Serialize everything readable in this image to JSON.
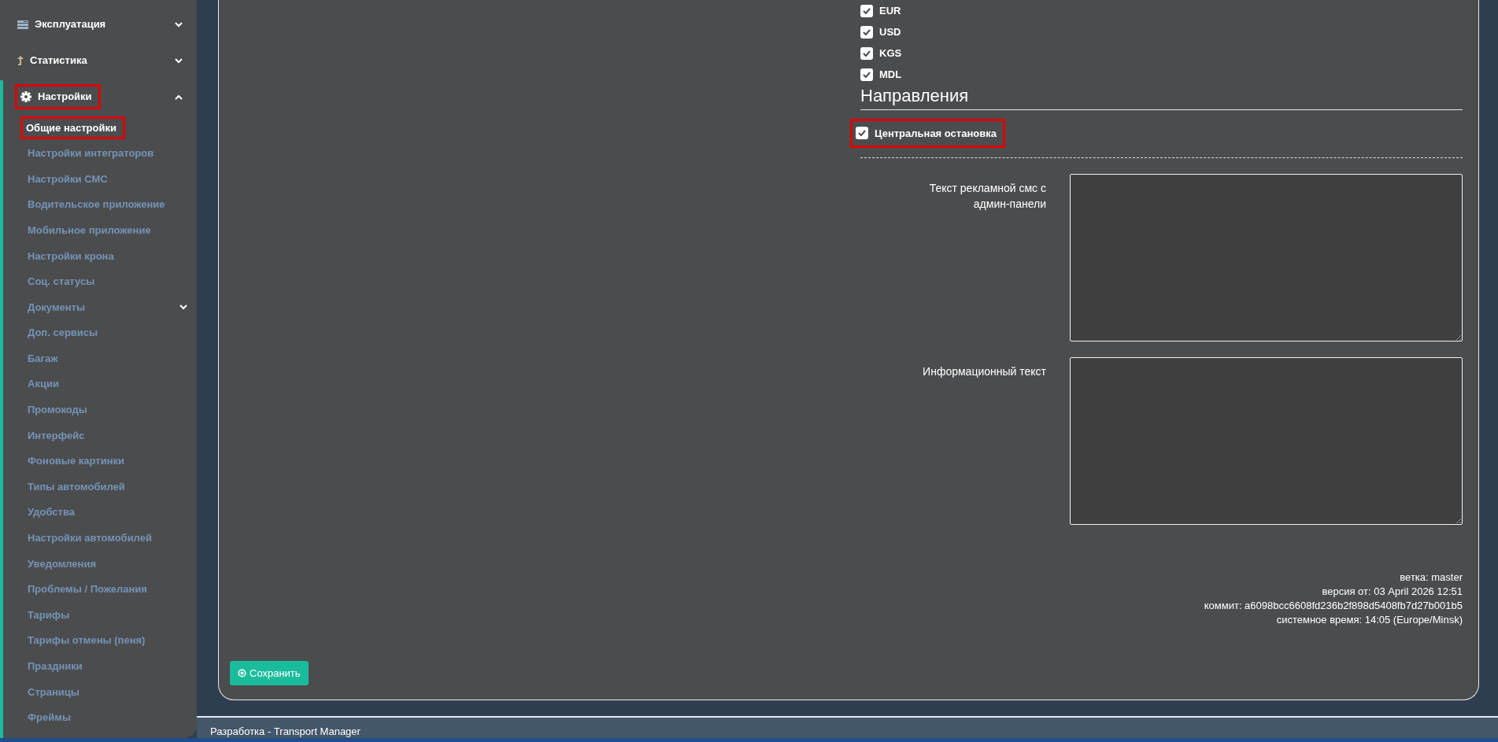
{
  "sidebar": {
    "items": [
      {
        "label": "Эксплуатация",
        "expanded": false,
        "highlighted": false
      },
      {
        "label": "Статистика",
        "expanded": false,
        "highlighted": false
      },
      {
        "label": "Настройки",
        "expanded": true,
        "highlighted": true,
        "children": [
          {
            "label": "Общие настройки",
            "selected": true,
            "highlighted": true,
            "submenu": false
          },
          {
            "label": "Настройки интеграторов",
            "selected": false,
            "highlighted": false,
            "submenu": false
          },
          {
            "label": "Настройки СМС",
            "selected": false,
            "highlighted": false,
            "submenu": false
          },
          {
            "label": "Водительское приложение",
            "selected": false,
            "highlighted": false,
            "submenu": false
          },
          {
            "label": "Мобильное приложение",
            "selected": false,
            "highlighted": false,
            "submenu": false
          },
          {
            "label": "Настройки крона",
            "selected": false,
            "highlighted": false,
            "submenu": false
          },
          {
            "label": "Соц. статусы",
            "selected": false,
            "highlighted": false,
            "submenu": false
          },
          {
            "label": "Документы",
            "selected": false,
            "highlighted": false,
            "submenu": true
          },
          {
            "label": "Доп. сервисы",
            "selected": false,
            "highlighted": false,
            "submenu": false
          },
          {
            "label": "Багаж",
            "selected": false,
            "highlighted": false,
            "submenu": false
          },
          {
            "label": "Акции",
            "selected": false,
            "highlighted": false,
            "submenu": false
          },
          {
            "label": "Промокоды",
            "selected": false,
            "highlighted": false,
            "submenu": false
          },
          {
            "label": "Интерфейс",
            "selected": false,
            "highlighted": false,
            "submenu": false
          },
          {
            "label": "Фоновые картинки",
            "selected": false,
            "highlighted": false,
            "submenu": false
          },
          {
            "label": "Типы автомобилей",
            "selected": false,
            "highlighted": false,
            "submenu": false
          },
          {
            "label": "Удобства",
            "selected": false,
            "highlighted": false,
            "submenu": false
          },
          {
            "label": "Настройки автомобилей",
            "selected": false,
            "highlighted": false,
            "submenu": false
          },
          {
            "label": "Уведомления",
            "selected": false,
            "highlighted": false,
            "submenu": false
          },
          {
            "label": "Проблемы / Пожелания",
            "selected": false,
            "highlighted": false,
            "submenu": false
          },
          {
            "label": "Тарифы",
            "selected": false,
            "highlighted": false,
            "submenu": false
          },
          {
            "label": "Тарифы отмены (пеня)",
            "selected": false,
            "highlighted": false,
            "submenu": false
          },
          {
            "label": "Праздники",
            "selected": false,
            "highlighted": false,
            "submenu": false
          },
          {
            "label": "Страницы",
            "selected": false,
            "highlighted": false,
            "submenu": false
          },
          {
            "label": "Фреймы",
            "selected": false,
            "highlighted": false,
            "submenu": false
          }
        ]
      }
    ]
  },
  "currencies": [
    {
      "label": "EUR",
      "checked": true
    },
    {
      "label": "USD",
      "checked": true
    },
    {
      "label": "KGS",
      "checked": true
    },
    {
      "label": "MDL",
      "checked": true
    }
  ],
  "directions": {
    "heading": "Направления",
    "options": [
      {
        "label": "Центральная остановка",
        "checked": true,
        "highlighted": true
      }
    ]
  },
  "fields": [
    {
      "label": "Текст рекламной смс с админ-панели"
    },
    {
      "label": "Информационный текст"
    }
  ],
  "version_info": [
    "ветка: master",
    "версия от: 03 April 2026 12:51",
    "коммит: a6098bcc6608fd236b2f898d5408fb7d27b001b5",
    "системное время: 14:05 (Europe/Minsk)"
  ],
  "save_button": "Сохранить",
  "footer": "Разработка - Transport Manager"
}
